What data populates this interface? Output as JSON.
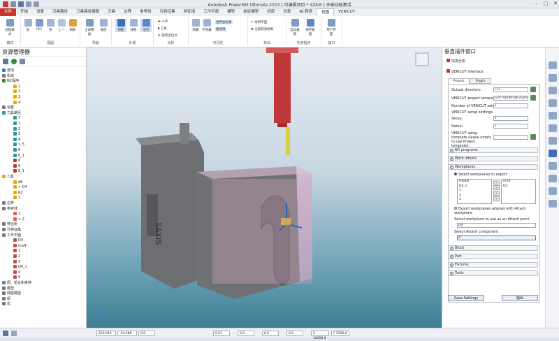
{
  "window": {
    "title": "Autodesk PowerMill Ultimate 2023   [ 可编辑项目 * 4ZKM ]   多轴功能激活"
  },
  "tabs": [
    "文件",
    "开始",
    "设置",
    "刀具路径",
    "刀具路径编辑",
    "刀具",
    "边界",
    "参考线",
    "孔特征集",
    "特征组",
    "工作平面",
    "模型",
    "拖延模型",
    "机床",
    "仿真",
    "NC程序",
    "视图",
    "VERICUT"
  ],
  "ribbon": {
    "groups": [
      "模式",
      "视图",
      "导航",
      "外观",
      "光标",
      "可见性",
      "条目",
      "实用程序",
      "窗口"
    ],
    "buttons": {
      "view_mode": "视图模式",
      "front": "前",
      "iso": "ISO",
      "top": "顶",
      "up": "上一",
      "refresh": "刷新",
      "fullscreen": "全屏重画",
      "zoom": "缩放",
      "shaded": "阴影",
      "wire": "线框",
      "hidden": "毛坯",
      "cross": "十字",
      "tool": "刀具",
      "rotate_pos": "旋转定位点",
      "hide": "隐藏",
      "no_hide": "不隐藏",
      "world_coord": "世界坐标系",
      "activate": "激活项",
      "draw_plain": "绘制平面",
      "show_all": "全部取消绘制",
      "auto_collision": "自动截图",
      "save_view": "保存截图",
      "user_interface": "用户界面"
    }
  },
  "explorer": {
    "title": "资源管理器",
    "tree": [
      {
        "label": "激活",
        "indent": 0,
        "color": "#2f7fd6"
      },
      {
        "label": "机床",
        "indent": 0,
        "color": "#7a7a7a"
      },
      {
        "label": "NC程序",
        "indent": 0,
        "color": "#3a8a3a"
      },
      {
        "label": "1",
        "indent": 2,
        "color": "#e0b000"
      },
      {
        "label": "2",
        "indent": 2,
        "color": "#e0b000"
      },
      {
        "label": "3",
        "indent": 2,
        "color": "#e0b000"
      },
      {
        "label": "4",
        "indent": 2,
        "color": "#e0b000"
      },
      {
        "label": "设置",
        "indent": 0,
        "color": "#7a7a7a"
      },
      {
        "label": "刀具路径",
        "indent": 0,
        "color": "#2a9a9a"
      },
      {
        "label": "7",
        "indent": 2,
        "color": "#2a9a9a"
      },
      {
        "label": "1",
        "indent": 2,
        "color": "#2a9a9a"
      },
      {
        "label": "2",
        "indent": 2,
        "color": "#2a9a9a"
      },
      {
        "label": "3",
        "indent": 2,
        "color": "#2a9a9a"
      },
      {
        "label": "4",
        "indent": 2,
        "color": "#2a9a9a"
      },
      {
        "label": "> 5",
        "indent": 2,
        "color": "#2a9a9a"
      },
      {
        "label": "6",
        "indent": 2,
        "color": "#2a9a9a"
      },
      {
        "label": "6_1",
        "indent": 2,
        "color": "#2a9a9a"
      },
      {
        "label": "8",
        "indent": 2,
        "color": "#c0392b"
      },
      {
        "label": "9",
        "indent": 2,
        "color": "#c0392b"
      },
      {
        "label": "8_1",
        "indent": 2,
        "color": "#c0392b"
      },
      {
        "label": "刀具",
        "indent": 0,
        "color": "#e0b000"
      },
      {
        "label": "d8",
        "indent": 2,
        "color": "#e0b000"
      },
      {
        "label": "> D4",
        "indent": 2,
        "color": "#e0b000"
      },
      {
        "label": "R2",
        "indent": 2,
        "color": "#e0b000"
      },
      {
        "label": "1",
        "indent": 2,
        "color": "#e0b000"
      },
      {
        "label": "边界",
        "indent": 0,
        "color": "#7a7a7a"
      },
      {
        "label": "参考线",
        "indent": 0,
        "color": "#7a7a7a"
      },
      {
        "label": "1",
        "indent": 2,
        "color": "#e06060"
      },
      {
        "label": "> 2",
        "indent": 2,
        "color": "#e06060"
      },
      {
        "label": "特征组",
        "indent": 0,
        "color": "#7a7a7a"
      },
      {
        "label": "孔特征集",
        "indent": 0,
        "color": "#7a7a7a"
      },
      {
        "label": "工作平面",
        "indent": 0,
        "color": "#7a7a7a"
      },
      {
        "label": "D4",
        "indent": 2,
        "color": "#c05050"
      },
      {
        "label": "ncs4",
        "indent": 2,
        "color": "#c05050"
      },
      {
        "label": "1",
        "indent": 2,
        "color": "#c05050"
      },
      {
        "label": "2",
        "indent": 2,
        "color": "#c05050"
      },
      {
        "label": "3",
        "indent": 2,
        "color": "#c05050"
      },
      {
        "label": "D4_1",
        "indent": 2,
        "color": "#c05050"
      },
      {
        "label": "4",
        "indent": 2,
        "color": "#c05050"
      },
      {
        "label": "5",
        "indent": 2,
        "color": "#c05050"
      },
      {
        "label": "层、组合和夹持",
        "indent": 0,
        "color": "#7a7a7a"
      },
      {
        "label": "模型",
        "indent": 0,
        "color": "#7a7a7a"
      },
      {
        "label": "残留模型",
        "indent": 0,
        "color": "#7a7a7a"
      },
      {
        "label": "组",
        "indent": 0,
        "color": "#7a7a7a"
      },
      {
        "label": "宏",
        "indent": 0,
        "color": "#7a7a7a"
      }
    ]
  },
  "panel": {
    "title": "垂直插件窗口",
    "sim_label": "仿真分析",
    "plugin_label": "VERICUT Interface",
    "tabs": [
      "Project options",
      "Plugin options"
    ],
    "output_dir_label": "Output directory:",
    "output_dir_value": "F:\\1",
    "template_label": "VERICUT project template:",
    "template_value": "G:\\YT\\42\\ATQB.vcpro",
    "num_setups_label": "Number of VERICUT setups:",
    "num_setups_value": "1",
    "setup_settings_label": "VERICUT setup settings:",
    "setup_label": "Setup:",
    "setup_value": "1",
    "name_label": "Name:",
    "name_value": "1",
    "setup_template_label": "VERICUT setup template (leave empty to use Project template):",
    "sections_top": [
      "NC programs",
      "Work offsets",
      "Workplanes"
    ],
    "select_workplanes_label": "Select workplanes to export",
    "left_list": [
      "Global",
      "D4_1",
      "1",
      "2",
      "3"
    ],
    "right_list": [
      "ncs4",
      "D4"
    ],
    "aligned_label": "Export workplanes aligned with Attach workplane",
    "attach_point_label": "Select workplane to use as an Attach point",
    "attach_point_value": "D4",
    "attach_comp_label": "Select Attach component",
    "attach_comp_value": "A",
    "sections_bottom": [
      "Block",
      "Part",
      "Fixtures",
      "Tools"
    ],
    "save_btn": "Save Settings",
    "output_btn": "输出"
  },
  "statusbar": {
    "x": "250.019",
    "y": "-24.588",
    "z": "0.0",
    "tol": "0.01",
    "a": "0.0",
    "b": "6.0",
    "c": "0.0",
    "s": "S 10000.0",
    "f": "F 2500.0"
  },
  "colors": {
    "accent": "#2f7fd6",
    "file_tab": "#c9372c",
    "tool_red": "#c0373a",
    "tool_yellow": "#d8d040",
    "part_gray": "#6c6e72",
    "stock_pink": "#d6a9c4"
  }
}
